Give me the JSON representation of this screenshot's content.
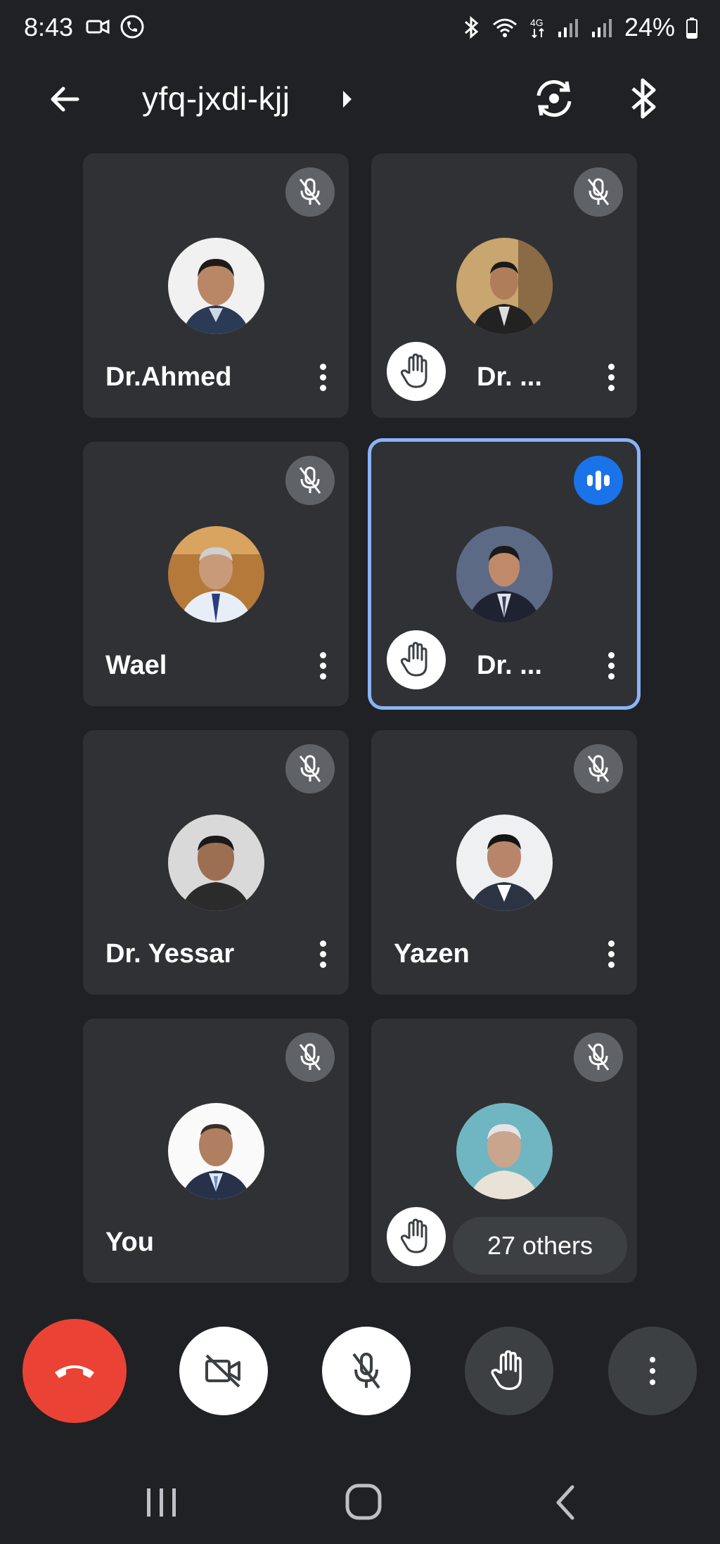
{
  "status_bar": {
    "time": "8:43",
    "battery": "24%",
    "left_icons": [
      "video-call-icon",
      "whatsapp-icon"
    ],
    "right_icons": [
      "bluetooth-icon",
      "wifi-icon",
      "4g-icon",
      "signal-icon",
      "signal-icon",
      "battery-icon"
    ]
  },
  "app_bar": {
    "meeting_code": "yfq-jxdi-kjj",
    "icons": [
      "back-arrow-icon",
      "caret-right-icon",
      "switch-camera-icon",
      "bluetooth-audio-icon"
    ]
  },
  "participants": [
    {
      "name": "Dr.Ahmed",
      "muted": true,
      "hand_raised": false,
      "speaking": false
    },
    {
      "name": "Dr. ...",
      "muted": true,
      "hand_raised": true,
      "speaking": false
    },
    {
      "name": "Wael",
      "muted": true,
      "hand_raised": false,
      "speaking": false
    },
    {
      "name": "Dr. ...",
      "muted": false,
      "hand_raised": true,
      "speaking": true
    },
    {
      "name": "Dr. Yessar",
      "muted": true,
      "hand_raised": false,
      "speaking": false
    },
    {
      "name": "Yazen",
      "muted": true,
      "hand_raised": false,
      "speaking": false
    },
    {
      "name": "You",
      "muted": true,
      "hand_raised": false,
      "speaking": false
    },
    {
      "name": "",
      "muted": true,
      "hand_raised": true,
      "speaking": false
    }
  ],
  "others_pill": "27 others",
  "controls": {
    "icons": [
      "end-call-icon",
      "camera-off-icon",
      "mic-off-icon",
      "raise-hand-icon",
      "more-vert-icon"
    ],
    "colors": {
      "end_call": "#ea4335",
      "active_border": "#8ab4f8",
      "speaking_badge": "#1a73e8"
    }
  },
  "nav_bar": {
    "icons": [
      "recents-icon",
      "home-icon",
      "back-icon"
    ]
  }
}
